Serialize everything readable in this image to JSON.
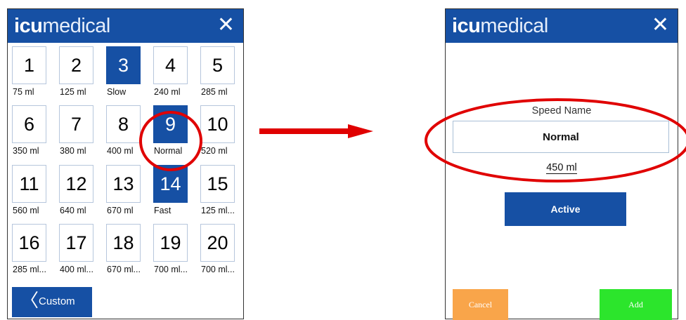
{
  "left_panel": {
    "logo_bold": "icu",
    "logo_light": "medical",
    "close_glyph": "✕",
    "tiles": [
      {
        "number": "1",
        "label": "75 ml",
        "selected": false
      },
      {
        "number": "2",
        "label": "125 ml",
        "selected": false
      },
      {
        "number": "3",
        "label": "Slow",
        "selected": true
      },
      {
        "number": "4",
        "label": "240 ml",
        "selected": false
      },
      {
        "number": "5",
        "label": "285 ml",
        "selected": false
      },
      {
        "number": "6",
        "label": "350 ml",
        "selected": false
      },
      {
        "number": "7",
        "label": "380 ml",
        "selected": false
      },
      {
        "number": "8",
        "label": "400 ml",
        "selected": false
      },
      {
        "number": "9",
        "label": "Normal",
        "selected": true
      },
      {
        "number": "10",
        "label": "520 ml",
        "selected": false
      },
      {
        "number": "11",
        "label": "560 ml",
        "selected": false
      },
      {
        "number": "12",
        "label": "640 ml",
        "selected": false
      },
      {
        "number": "13",
        "label": "670 ml",
        "selected": false
      },
      {
        "number": "14",
        "label": "Fast",
        "selected": true
      },
      {
        "number": "15",
        "label": "125 ml...",
        "selected": false
      },
      {
        "number": "16",
        "label": "285 ml...",
        "selected": false
      },
      {
        "number": "17",
        "label": "400 ml...",
        "selected": false
      },
      {
        "number": "18",
        "label": "670 ml...",
        "selected": false
      },
      {
        "number": "19",
        "label": "700 ml...",
        "selected": false
      },
      {
        "number": "20",
        "label": "700 ml...",
        "selected": false
      }
    ],
    "custom_chevron": "〈",
    "custom_label": "Custom"
  },
  "right_panel": {
    "logo_bold": "icu",
    "logo_light": "medical",
    "close_glyph": "✕",
    "speed_name_label": "Speed Name",
    "speed_name_value": "Normal",
    "volume": "450 ml",
    "active_label": "Active",
    "cancel_label": "Cancel",
    "add_label": "Add"
  },
  "colors": {
    "brand_blue": "#1650a4",
    "highlight_red": "#e00000",
    "cancel_orange": "#f9a54a",
    "add_green": "#2ce52c"
  },
  "icons": {
    "close": "close-icon",
    "back": "chevron-left-icon",
    "arrow": "arrow-right-icon"
  }
}
